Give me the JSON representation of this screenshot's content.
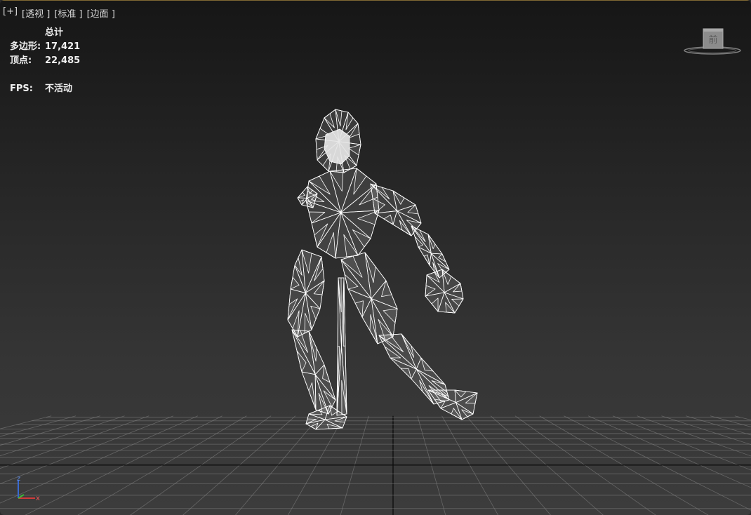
{
  "viewport": {
    "labels": [
      "[+]",
      "[透视 ]",
      "[标准 ]",
      "[边面 ]"
    ]
  },
  "stats": {
    "header": "总计",
    "polygons_label": "多边形:",
    "polygons_value": "17,421",
    "vertices_label": "顶点:",
    "vertices_value": "22,485",
    "fps_label": "FPS:",
    "fps_value": "不活动"
  },
  "viewcube": {
    "face_label": "前"
  },
  "axis_tripod": {
    "z_label": "z",
    "x_label": "x"
  },
  "colors": {
    "grid": "#8a8a8a",
    "grid_major": "#0a0a0a",
    "wireframe": "#ffffff",
    "axis_x": "#d23a3a",
    "axis_y": "#3ab83a",
    "axis_z": "#3a6ad2"
  },
  "icons": [
    "viewcube-icon",
    "axis-tripod-icon"
  ]
}
